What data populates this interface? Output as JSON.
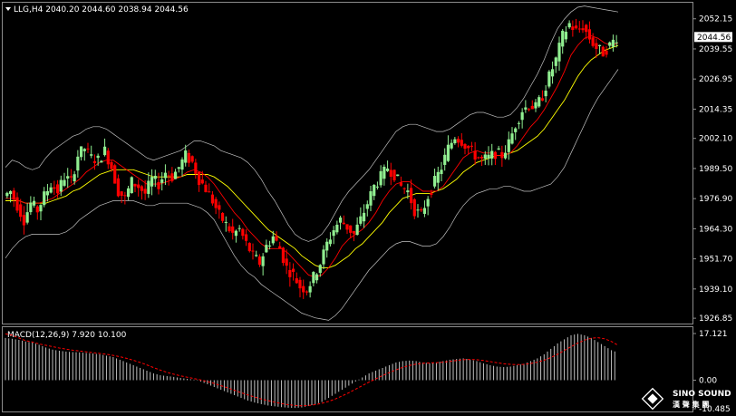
{
  "header": {
    "symbol_line": "LLG,H4  2040.20 2044.60 2038.94 2044.56"
  },
  "macd": {
    "label": "MACD(12,26,9) 7.920 10.100",
    "ticks": [
      {
        "value": 17.121,
        "label": "17.121"
      },
      {
        "value": 0,
        "label": "0.00"
      },
      {
        "value": -10.485,
        "label": "-10.485"
      }
    ]
  },
  "price_axis": {
    "current_price": 2044.56,
    "current_label": "2044.56"
  },
  "watermark": {
    "text": "SINO SOUND",
    "subtext": "漢 聲 集 團"
  },
  "colors": {
    "background": "#000000",
    "bull_candle": "#90EE90",
    "bear_candle": "#FF0000",
    "bollinger": "#C0C0C0",
    "ma_fast": "#FF0000",
    "ma_slow": "#FFFF00",
    "macd_hist": "#C0C0C0",
    "macd_signal": "#FF0000",
    "text": "#FFFFFF"
  },
  "chart_data": {
    "type": "candlestick",
    "y_ticks": [
      2052.15,
      2039.55,
      2026.95,
      2014.35,
      2002.1,
      1989.5,
      1976.9,
      1964.3,
      1951.7,
      1939.1,
      1926.85
    ],
    "y_tick_labels": [
      "2052.15",
      "2039.55",
      "2026.95",
      "2014.35",
      "2002.10",
      "1989.50",
      "1976.90",
      "1964.30",
      "1951.70",
      "1939.10",
      "1926.85"
    ],
    "ylim": [
      1925.0,
      2058.5
    ],
    "macd_ylim": [
      -10.485,
      17.121
    ],
    "close_path": [
      1978,
      1980,
      1974,
      1968,
      1975,
      1972,
      1978,
      1983,
      1980,
      1986,
      1984,
      1995,
      1998,
      1994,
      1993,
      1997,
      1990,
      1980,
      1977,
      1984,
      1982,
      1979,
      1985,
      1983,
      1988,
      1986,
      1990,
      1995,
      1992,
      1985,
      1981,
      1976,
      1970,
      1966,
      1962,
      1964,
      1958,
      1953,
      1950,
      1957,
      1961,
      1956,
      1948,
      1945,
      1940,
      1939,
      1944,
      1950,
      1958,
      1964,
      1968,
      1965,
      1962,
      1968,
      1975,
      1982,
      1986,
      1990,
      1987,
      1982,
      1980,
      1972,
      1970,
      1978,
      1984,
      1990,
      1998,
      2003,
      2001,
      1998,
      1995,
      1993,
      1994,
      1996,
      1995,
      2000,
      2008,
      2014,
      2016,
      2015,
      2020,
      2028,
      2035,
      2045,
      2050,
      2047,
      2049,
      2044,
      2040,
      2038,
      2041,
      2044.56
    ],
    "ma_fast": [
      1977,
      1977,
      1976,
      1975,
      1975,
      1975,
      1976,
      1977,
      1979,
      1981,
      1983,
      1985,
      1988,
      1990,
      1992,
      1993,
      1993,
      1991,
      1989,
      1987,
      1985,
      1983,
      1983,
      1983,
      1984,
      1985,
      1986,
      1988,
      1989,
      1988,
      1986,
      1983,
      1979,
      1975,
      1971,
      1968,
      1964,
      1961,
      1958,
      1956,
      1956,
      1956,
      1954,
      1951,
      1948,
      1945,
      1944,
      1945,
      1948,
      1952,
      1957,
      1960,
      1962,
      1964,
      1967,
      1971,
      1976,
      1980,
      1983,
      1984,
      1984,
      1982,
      1980,
      1980,
      1980,
      1982,
      1986,
      1990,
      1994,
      1996,
      1997,
      1996,
      1996,
      1995,
      1995,
      1996,
      1999,
      2003,
      2007,
      2010,
      2014,
      2019,
      2024,
      2030,
      2037,
      2041,
      2044,
      2045,
      2044,
      2042,
      2041,
      2042
    ],
    "ma_slow": [
      1976,
      1976,
      1976,
      1975,
      1975,
      1975,
      1975,
      1976,
      1977,
      1978,
      1980,
      1981,
      1983,
      1985,
      1987,
      1988,
      1989,
      1989,
      1989,
      1989,
      1988,
      1987,
      1986,
      1986,
      1986,
      1986,
      1986,
      1987,
      1987,
      1987,
      1987,
      1986,
      1984,
      1982,
      1979,
      1976,
      1973,
      1970,
      1967,
      1964,
      1962,
      1960,
      1958,
      1956,
      1953,
      1951,
      1949,
      1948,
      1948,
      1949,
      1951,
      1953,
      1956,
      1958,
      1961,
      1964,
      1967,
      1971,
      1974,
      1977,
      1978,
      1979,
      1979,
      1979,
      1980,
      1981,
      1983,
      1985,
      1988,
      1990,
      1992,
      1993,
      1994,
      1995,
      1995,
      1996,
      1997,
      1999,
      2001,
      2003,
      2006,
      2010,
      2014,
      2018,
      2023,
      2028,
      2032,
      2035,
      2037,
      2039,
      2040,
      2041
    ],
    "boll_upper": [
      1990,
      1993,
      1992,
      1990,
      1989,
      1990,
      1994,
      1997,
      1999,
      2001,
      2003,
      2004,
      2006,
      2007,
      2007,
      2006,
      2004,
      2002,
      2000,
      1998,
      1996,
      1994,
      1993,
      1994,
      1995,
      1996,
      1997,
      1999,
      2001,
      2001,
      2000,
      1999,
      1997,
      1996,
      1995,
      1994,
      1992,
      1989,
      1985,
      1980,
      1976,
      1971,
      1966,
      1962,
      1960,
      1959,
      1960,
      1962,
      1966,
      1971,
      1976,
      1980,
      1983,
      1986,
      1989,
      1993,
      1997,
      2001,
      2005,
      2007,
      2008,
      2008,
      2007,
      2006,
      2005,
      2005,
      2006,
      2008,
      2010,
      2012,
      2013,
      2013,
      2012,
      2011,
      2011,
      2012,
      2015,
      2019,
      2024,
      2029,
      2035,
      2042,
      2048,
      2052,
      2055,
      2057,
      2057.5,
      2057,
      2056.5,
      2056,
      2055.5,
      2055
    ],
    "boll_lower": [
      1952,
      1956,
      1959,
      1961,
      1962,
      1962,
      1962,
      1962,
      1962,
      1963,
      1965,
      1968,
      1970,
      1972,
      1974,
      1975,
      1976,
      1976,
      1976,
      1976,
      1975,
      1974,
      1974,
      1975,
      1975,
      1975,
      1975,
      1975,
      1974,
      1973,
      1971,
      1968,
      1963,
      1958,
      1953,
      1949,
      1946,
      1944,
      1941,
      1939,
      1937,
      1935,
      1933,
      1931,
      1929,
      1928,
      1927,
      1926.5,
      1926,
      1928,
      1931,
      1935,
      1939,
      1943,
      1947,
      1950,
      1953,
      1956,
      1958,
      1959,
      1959,
      1958,
      1957,
      1957,
      1958,
      1961,
      1965,
      1970,
      1974,
      1977,
      1979,
      1980,
      1981,
      1981,
      1982,
      1982,
      1981,
      1980,
      1980,
      1981,
      1982,
      1983,
      1986,
      1990,
      1996,
      2002,
      2008,
      2014,
      2019,
      2023,
      2027,
      2031
    ],
    "macd_hist": [
      15.5,
      15.2,
      14.8,
      14.2,
      13.8,
      13.0,
      12.0,
      11.2,
      10.8,
      10.5,
      10.3,
      10.2,
      10.0,
      9.8,
      9.5,
      9.0,
      8.5,
      7.5,
      6.5,
      5.5,
      4.5,
      3.5,
      2.5,
      1.8,
      1.5,
      1.2,
      0.8,
      0.5,
      0.2,
      -0.5,
      -1.5,
      -2.5,
      -3.5,
      -4.5,
      -5.5,
      -6.5,
      -7.5,
      -8.2,
      -8.8,
      -9.3,
      -9.6,
      -9.9,
      -10.1,
      -10.2,
      -10.0,
      -9.5,
      -8.8,
      -8.0,
      -6.5,
      -5.0,
      -3.5,
      -2.0,
      -0.5,
      1.0,
      2.5,
      3.5,
      4.5,
      5.5,
      6.5,
      7.0,
      7.2,
      7.0,
      6.5,
      6.2,
      6.5,
      7.0,
      7.5,
      7.8,
      8.0,
      7.6,
      7.0,
      6.2,
      5.5,
      5.0,
      4.8,
      5.0,
      5.5,
      6.0,
      7.0,
      8.0,
      9.5,
      11.5,
      13.5,
      15.0,
      16.5,
      17.0,
      16.5,
      15.5,
      14.0,
      12.5,
      11.0,
      10.1
    ],
    "macd_signal": [
      17.0,
      16.5,
      15.5,
      14.5,
      14.0,
      13.3,
      12.8,
      12.3,
      11.8,
      11.4,
      11.0,
      10.7,
      10.4,
      10.1,
      9.8,
      9.5,
      9.1,
      8.6,
      8.0,
      7.3,
      6.5,
      5.6,
      4.6,
      3.7,
      2.9,
      2.2,
      1.6,
      1.1,
      0.6,
      0.1,
      -0.5,
      -1.2,
      -2.0,
      -2.8,
      -3.7,
      -4.6,
      -5.4,
      -6.2,
      -6.9,
      -7.5,
      -8.1,
      -8.6,
      -9.0,
      -9.3,
      -9.4,
      -9.3,
      -9.0,
      -8.5,
      -7.8,
      -6.9,
      -5.8,
      -4.6,
      -3.3,
      -2.0,
      -0.7,
      0.5,
      1.7,
      2.8,
      3.8,
      4.7,
      5.4,
      5.9,
      6.2,
      6.3,
      6.4,
      6.6,
      6.9,
      7.2,
      7.5,
      7.6,
      7.5,
      7.2,
      6.8,
      6.4,
      6.0,
      5.8,
      5.7,
      5.8,
      6.1,
      6.6,
      7.3,
      8.3,
      9.5,
      10.9,
      12.3,
      13.6,
      14.7,
      15.4,
      15.6,
      15.2,
      14.2,
      12.8
    ]
  }
}
